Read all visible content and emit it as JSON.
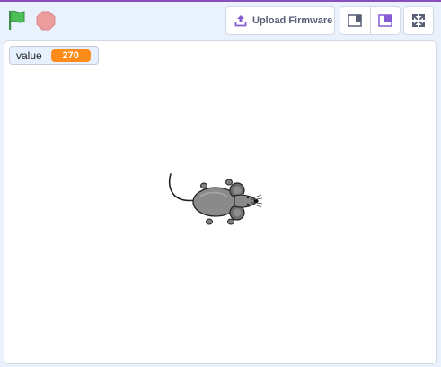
{
  "toolbar": {
    "green_flag_icon": "green-flag-icon",
    "stop_icon": "stop-sign-icon",
    "upload_firmware_label": "Upload Firmware",
    "upload_icon": "upload-icon",
    "small_stage_icon": "small-stage-icon",
    "large_stage_icon": "large-stage-icon",
    "fullscreen_icon": "fullscreen-icon"
  },
  "stage": {
    "monitor": {
      "label": "value",
      "value": "270"
    },
    "sprite": {
      "name": "mouse-sprite"
    }
  },
  "colors": {
    "accent_purple": "#8a4fbf",
    "flag_green": "#4cbf56",
    "stop_red": "#ec9c9c",
    "monitor_orange": "#ff8c1a",
    "toolbar_background": "#e9f1fc",
    "icon_purple": "#855cd6"
  }
}
